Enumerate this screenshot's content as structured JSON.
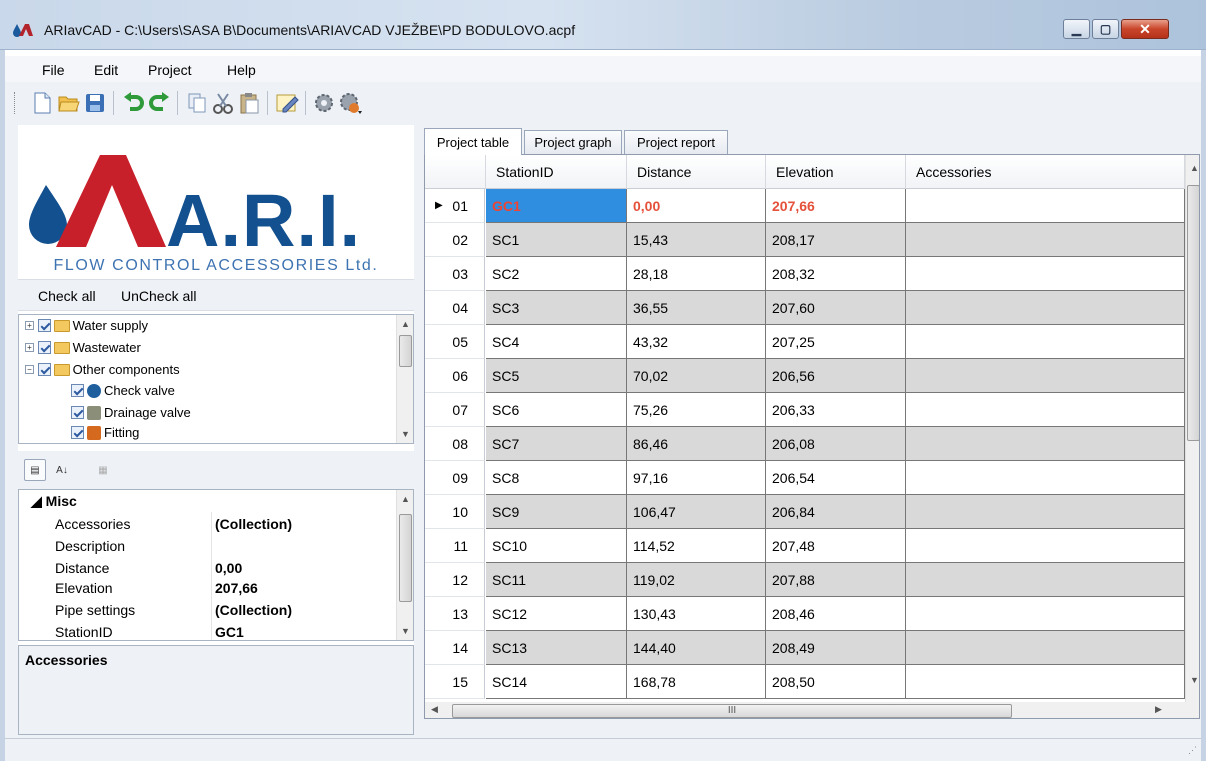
{
  "window": {
    "title": "ARIavCAD - C:\\Users\\SASA B\\Documents\\ARIAVCAD VJEŽBE\\PD BODULOVO.acpf",
    "controls": {
      "minimize": "▁",
      "maximize": "▢",
      "close": "✕"
    }
  },
  "menu": {
    "file": "File",
    "edit": "Edit",
    "project": "Project",
    "help": "Help"
  },
  "toolbar": {
    "icons": [
      "new-document-icon",
      "open-folder-icon",
      "save-icon",
      "undo-icon",
      "redo-icon",
      "copy-icon",
      "cut-icon",
      "paste-icon",
      "edit-icon",
      "settings-gear-icon",
      "settings-dropdown-icon"
    ]
  },
  "logo": {
    "brand": "A.R.I.",
    "tagline": "FLOW CONTROL ACCESSORIES Ltd."
  },
  "checkbar": {
    "check_all": "Check all",
    "uncheck_all": "UnCheck all"
  },
  "tree": {
    "items": [
      {
        "label": "Water supply",
        "expander": "+"
      },
      {
        "label": "Wastewater",
        "expander": "+"
      },
      {
        "label": "Other components",
        "expander": "−"
      },
      {
        "label": "Check valve"
      },
      {
        "label": "Drainage valve"
      },
      {
        "label": "Fitting"
      }
    ]
  },
  "props": {
    "category": "Misc",
    "rows": [
      {
        "name": "Accessories",
        "value": "(Collection)"
      },
      {
        "name": "Description",
        "value": ""
      },
      {
        "name": "Distance",
        "value": "0,00"
      },
      {
        "name": "Elevation",
        "value": "207,66"
      },
      {
        "name": "Pipe settings",
        "value": "(Collection)"
      },
      {
        "name": "StationID",
        "value": "GC1"
      }
    ],
    "help_title": "Accessories"
  },
  "tabs": [
    "Project table",
    "Project graph",
    "Project report"
  ],
  "grid": {
    "columns": [
      "StationID",
      "Distance",
      "Elevation",
      "Accessories"
    ],
    "rows": [
      {
        "n": "01",
        "id": "GC1",
        "dist": "0,00",
        "elev": "207,66",
        "acc": ""
      },
      {
        "n": "02",
        "id": "SC1",
        "dist": "15,43",
        "elev": "208,17",
        "acc": ""
      },
      {
        "n": "03",
        "id": "SC2",
        "dist": "28,18",
        "elev": "208,32",
        "acc": ""
      },
      {
        "n": "04",
        "id": "SC3",
        "dist": "36,55",
        "elev": "207,60",
        "acc": ""
      },
      {
        "n": "05",
        "id": "SC4",
        "dist": "43,32",
        "elev": "207,25",
        "acc": ""
      },
      {
        "n": "06",
        "id": "SC5",
        "dist": "70,02",
        "elev": "206,56",
        "acc": ""
      },
      {
        "n": "07",
        "id": "SC6",
        "dist": "75,26",
        "elev": "206,33",
        "acc": ""
      },
      {
        "n": "08",
        "id": "SC7",
        "dist": "86,46",
        "elev": "206,08",
        "acc": ""
      },
      {
        "n": "09",
        "id": "SC8",
        "dist": "97,16",
        "elev": "206,54",
        "acc": ""
      },
      {
        "n": "10",
        "id": "SC9",
        "dist": "106,47",
        "elev": "206,84",
        "acc": ""
      },
      {
        "n": "11",
        "id": "SC10",
        "dist": "114,52",
        "elev": "207,48",
        "acc": ""
      },
      {
        "n": "12",
        "id": "SC11",
        "dist": "119,02",
        "elev": "207,88",
        "acc": ""
      },
      {
        "n": "13",
        "id": "SC12",
        "dist": "130,43",
        "elev": "208,46",
        "acc": ""
      },
      {
        "n": "14",
        "id": "SC13",
        "dist": "144,40",
        "elev": "208,49",
        "acc": ""
      },
      {
        "n": "15",
        "id": "SC14",
        "dist": "168,78",
        "elev": "208,50",
        "acc": ""
      }
    ],
    "selected_row_pointer": "▶",
    "scroll_grip": "III"
  },
  "colors": {
    "accent_blue": "#12508f",
    "logo_red": "#c8202b",
    "selected_cell": "#2f8ee0",
    "selected_text": "#e5503a",
    "alt_row": "#d9d9d9"
  }
}
